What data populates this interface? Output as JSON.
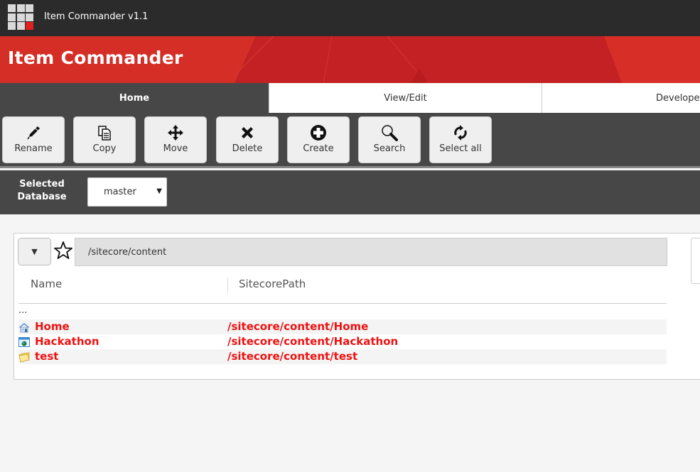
{
  "app": {
    "window_title": "Item Commander v1.1",
    "banner_title": "Item Commander",
    "brand_color": "#c42124",
    "accent_red": "#e0201f"
  },
  "tabs": [
    {
      "label": "Home",
      "active": true
    },
    {
      "label": "View/Edit",
      "active": false
    },
    {
      "label": "Developer",
      "active": false
    }
  ],
  "toolbar": {
    "buttons": [
      {
        "label": "Rename",
        "icon": "pen-icon"
      },
      {
        "label": "Copy",
        "icon": "copy-icon"
      },
      {
        "label": "Move",
        "icon": "move-arrows-icon"
      },
      {
        "label": "Delete",
        "icon": "x-icon"
      },
      {
        "label": "Create",
        "icon": "plus-circle-icon"
      },
      {
        "label": "Search",
        "icon": "magnifier-icon"
      },
      {
        "label": "Select all",
        "icon": "refresh-icon"
      }
    ]
  },
  "database": {
    "label": "Selected Database",
    "selected": "master"
  },
  "browser": {
    "path": "/sitecore/content",
    "columns": [
      "Name",
      "SitecorePath"
    ],
    "parent_link": "...",
    "items": [
      {
        "name": "Home",
        "path": "/sitecore/content/Home",
        "icon": "home-icon"
      },
      {
        "name": "Hackathon",
        "path": "/sitecore/content/Hackathon",
        "icon": "globe-window-icon"
      },
      {
        "name": "test",
        "path": "/sitecore/content/test",
        "icon": "folder-icon"
      }
    ]
  }
}
